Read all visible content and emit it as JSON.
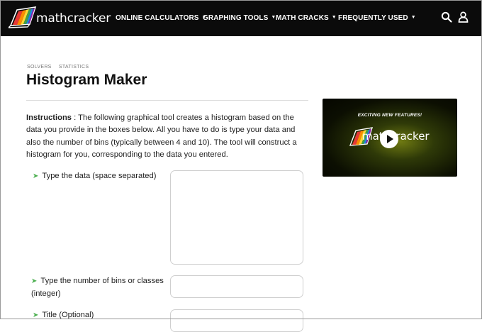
{
  "header": {
    "logo_text": "mathcracker",
    "nav": [
      {
        "label": "ONLINE CALCULATORS"
      },
      {
        "label": "GRAPHING TOOLS"
      },
      {
        "label": "MATH CRACKS"
      },
      {
        "label": "FREQUENTLY USED"
      }
    ]
  },
  "breadcrumb": {
    "items": [
      "SOLVERS",
      "STATISTICS"
    ]
  },
  "page_title": "Histogram Maker",
  "instructions": {
    "lead": "Instructions",
    "text": " : The following graphical tool creates a histogram based on the data you provide in the boxes below. All you have to do is type your data and also the number of bins (typically between 4 and 10). The tool will construct a histogram for you, corresponding to the data you entered."
  },
  "form": {
    "data_label": "Type the data (space separated)",
    "data_value": "",
    "bins_label": "Type the number of bins or classes (integer)",
    "bins_value": "",
    "title_label": "Title (Optional)",
    "title_value": ""
  },
  "video": {
    "tagline": "EXCITING NEW FEATURES!",
    "logo_text": "mathcracker"
  },
  "icons": {
    "search": "search-icon",
    "user": "user-icon",
    "play": "play-icon",
    "arrow": "green-arrow-icon"
  },
  "colors": {
    "topbar": "#0b0b0b",
    "bullet_arrow": "#4caf50"
  }
}
